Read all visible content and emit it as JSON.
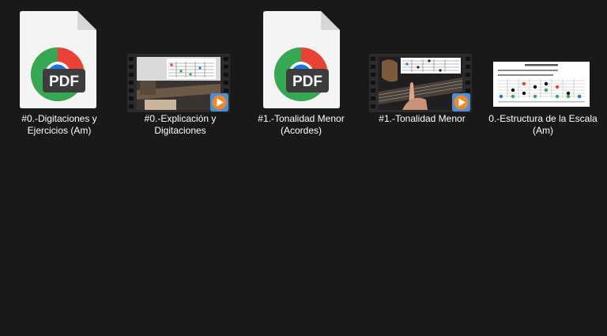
{
  "window": {
    "background": "#191919"
  },
  "files": [
    {
      "name": "#0.-Digitaciones y Ejercicios (Am)",
      "type": "pdf",
      "icon": "chrome-pdf-icon",
      "badge": "PDF"
    },
    {
      "name": "#0.-Explicación y Digitaciones",
      "type": "video",
      "icon": "video-thumbnail",
      "overlay_icon": "play-icon"
    },
    {
      "name": "#1.-Tonalidad Menor (Acordes)",
      "type": "pdf",
      "icon": "chrome-pdf-icon",
      "badge": "PDF"
    },
    {
      "name": "#1.-Tonalidad Menor",
      "type": "video",
      "icon": "video-thumbnail",
      "overlay_icon": "play-icon"
    },
    {
      "name": "0.-Estructura de la Escala (Am)",
      "type": "image",
      "icon": "image-thumbnail"
    }
  ],
  "colors": {
    "chrome_red": "#EA4335",
    "chrome_yellow": "#FBBC04",
    "chrome_green": "#34A853",
    "chrome_blue": "#1A73E8",
    "play_orange": "#F0892A",
    "play_blue": "#4A90D9"
  }
}
